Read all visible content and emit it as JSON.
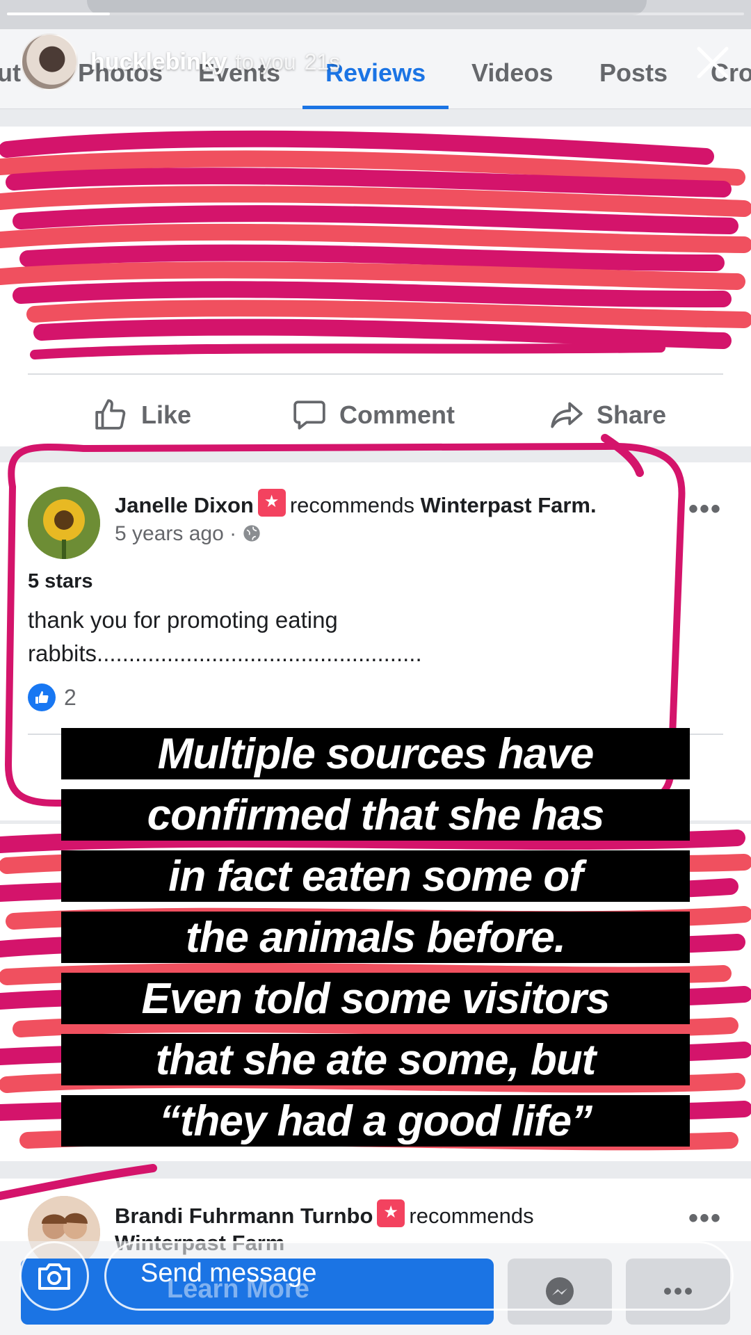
{
  "story": {
    "username": "hucklebinky",
    "recipient": "to you",
    "time_ago": "21s",
    "progress": 0.14
  },
  "tabs": [
    {
      "label": "ut"
    },
    {
      "label": "Photos"
    },
    {
      "label": "Events"
    },
    {
      "label": "Reviews",
      "active": true
    },
    {
      "label": "Videos"
    },
    {
      "label": "Posts"
    },
    {
      "label": "Cro"
    }
  ],
  "post_actions": {
    "like": "Like",
    "comment": "Comment",
    "share": "Share"
  },
  "review": {
    "author": "Janelle Dixon",
    "verb": "recommends",
    "page": "Winterpast Farm.",
    "time": "5 years ago",
    "rating": "5 stars",
    "body": "thank you for promoting eating rabbits...................................................",
    "like_count": "2"
  },
  "next_review": {
    "author": "Brandi Fuhrmann Turnbo",
    "verb": "recommends",
    "page": "Winterpast Farm"
  },
  "caption": [
    "Multiple sources have",
    "confirmed that she has",
    "in fact eaten some of",
    "the animals before.",
    "Even told some visitors",
    "that she ate some, but",
    "“they had a good life”"
  ],
  "bottom": {
    "learn_more": "Learn More",
    "send_message": "Send message"
  },
  "colors": {
    "scribble_magenta": "#d4146b",
    "scribble_coral": "#f0505f",
    "facebook_blue": "#1b74e4"
  }
}
